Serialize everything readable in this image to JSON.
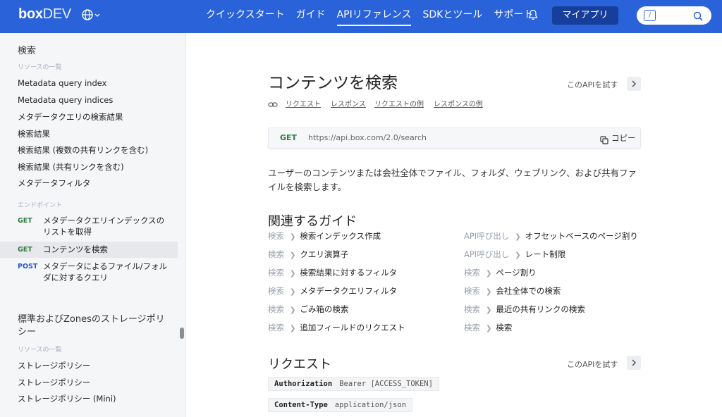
{
  "header": {
    "logo_box": "box",
    "logo_dev": "DEV",
    "nav": [
      {
        "label": "クイックスタート",
        "active": false
      },
      {
        "label": "ガイド",
        "active": false
      },
      {
        "label": "APIリファレンス",
        "active": true
      },
      {
        "label": "SDKとツール",
        "active": false
      },
      {
        "label": "サポート",
        "active": false
      }
    ],
    "my_apps": "マイアプリ",
    "search_key": "/",
    "colors": {
      "bar": "#2a62d9",
      "button": "#173e9a"
    }
  },
  "sidebar": {
    "section1_title": "検索",
    "section1_resources": "リソースの一覧",
    "resources": [
      "Metadata query index",
      "Metadata query indices",
      "メタデータクエリの検索結果",
      "検索結果",
      "検索結果 (複数の共有リンクを含む)",
      "検索結果 (共有リンクを含む)",
      "メタデータフィルタ"
    ],
    "endpoints_heading": "エンドポイント",
    "endpoints": [
      {
        "method": "GET",
        "label": "メタデータクエリインデックスのリストを取得",
        "active": false
      },
      {
        "method": "GET",
        "label": "コンテンツを検索",
        "active": true
      },
      {
        "method": "POST",
        "label": "メタデータによるファイル/フォルダに対するクエリ",
        "active": false
      }
    ],
    "section2_title": "標準およびZonesのストレージポリシー",
    "section2_resources": "リソースの一覧",
    "section2_items": [
      "ストレージポリシー",
      "ストレージポリシー",
      "ストレージポリシー (Mini)"
    ]
  },
  "main": {
    "title": "コンテンツを検索",
    "try_api": "このAPIを試す",
    "anchors": [
      "リクエスト",
      "レスポンス",
      "リクエストの例",
      "レスポンスの例"
    ],
    "endpoint": {
      "method": "GET",
      "url": "https://api.box.com/2.0/search",
      "copy": "コピー"
    },
    "description": "ユーザーのコンテンツまたは会社全体でファイル、フォルダ、ウェブリンク、および共有ファイルを検索します。",
    "related_heading": "関連するガイド",
    "guides_left": [
      {
        "category": "検索",
        "title": "検索インデックス作成"
      },
      {
        "category": "検索",
        "title": "クエリ演算子"
      },
      {
        "category": "検索",
        "title": "検索結果に対するフィルタ"
      },
      {
        "category": "検索",
        "title": "メタデータクエリフィルタ"
      },
      {
        "category": "検索",
        "title": "ごみ箱の検索"
      },
      {
        "category": "検索",
        "title": "追加フィールドのリクエスト"
      }
    ],
    "guides_right": [
      {
        "category": "API呼び出し",
        "title": "オフセットベースのページ割り"
      },
      {
        "category": "API呼び出し",
        "title": "レート制限"
      },
      {
        "category": "検索",
        "title": "ページ割り"
      },
      {
        "category": "検索",
        "title": "会社全体での検索"
      },
      {
        "category": "検索",
        "title": "最近の共有リンクの検索"
      },
      {
        "category": "検索",
        "title": "検索"
      }
    ],
    "request_heading": "リクエスト",
    "request_try_api": "このAPIを試す",
    "params": [
      {
        "name": "Authorization",
        "value": "Bearer [ACCESS_TOKEN]"
      },
      {
        "name": "Content-Type",
        "value": "application/json"
      }
    ]
  }
}
